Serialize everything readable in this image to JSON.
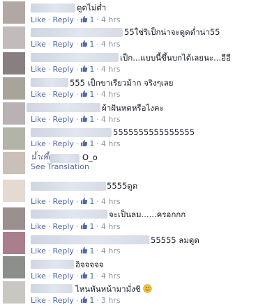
{
  "labels": {
    "like": "Like",
    "reply": "Reply",
    "dot": "·",
    "see_translation": "See Translation"
  },
  "colors": {
    "link": "#4e6aa7",
    "meta": "#8f96a3",
    "text": "#141823",
    "avatars": [
      "#b3a7a4",
      "#c2bbbb",
      "#8a7f80",
      "#a8a49a",
      "#b9b1b5",
      "#b3b4a8",
      "#c9c0ba",
      "#e4dad2",
      "#9b8f8f",
      "#a97f8d",
      "#8d8f8c",
      "#c9c7c2"
    ]
  },
  "icons": {
    "like": "thumbs-up-icon",
    "emoji": "smile-emoji-icon"
  },
  "comments": [
    {
      "name": "",
      "text": "ดูดไม่ต่ำ",
      "likes": "1",
      "age": "4 hrs"
    },
    {
      "name": "",
      "text": "55ใช่ริเป็กน่าจะดูดต่ำน่า55",
      "likes": "1",
      "age": "4 hrs"
    },
    {
      "name": "",
      "text": "เป็ก...แบบนี้ขึ้นบกได้เลยนะ...อีอี",
      "likes": "1",
      "age": "4 hrs"
    },
    {
      "name": "",
      "text": "555 เป็กขาเรียวม้าก จริงๆเลย",
      "likes": "1",
      "age": "4 hrs"
    },
    {
      "name": "",
      "text": "ผ้าฝันหดหรือไงคะ",
      "likes": "1",
      "age": "4 hrs"
    },
    {
      "name": "",
      "text": "5555555555555555",
      "likes": "1",
      "age": "4 hrs"
    },
    {
      "name": "น้ำเพี้ยว",
      "text": "O_o",
      "likes": "",
      "age": ""
    },
    {
      "name": "",
      "text": "5555ดูด",
      "likes": "1",
      "age": "4 hrs"
    },
    {
      "name": "",
      "text": "จะเป็นลม......ครอกกก",
      "likes": "1",
      "age": "4 hrs"
    },
    {
      "name": "",
      "text": "55555 ลมดูด",
      "likes": "1",
      "age": "4 hrs"
    },
    {
      "name": "",
      "text": "อิจจจจจ",
      "likes": "1",
      "age": "4 hrs"
    },
    {
      "name": "",
      "text": "ไหนหันหน้ามามั่งชิ",
      "likes": "1",
      "age": "3 hrs"
    }
  ]
}
